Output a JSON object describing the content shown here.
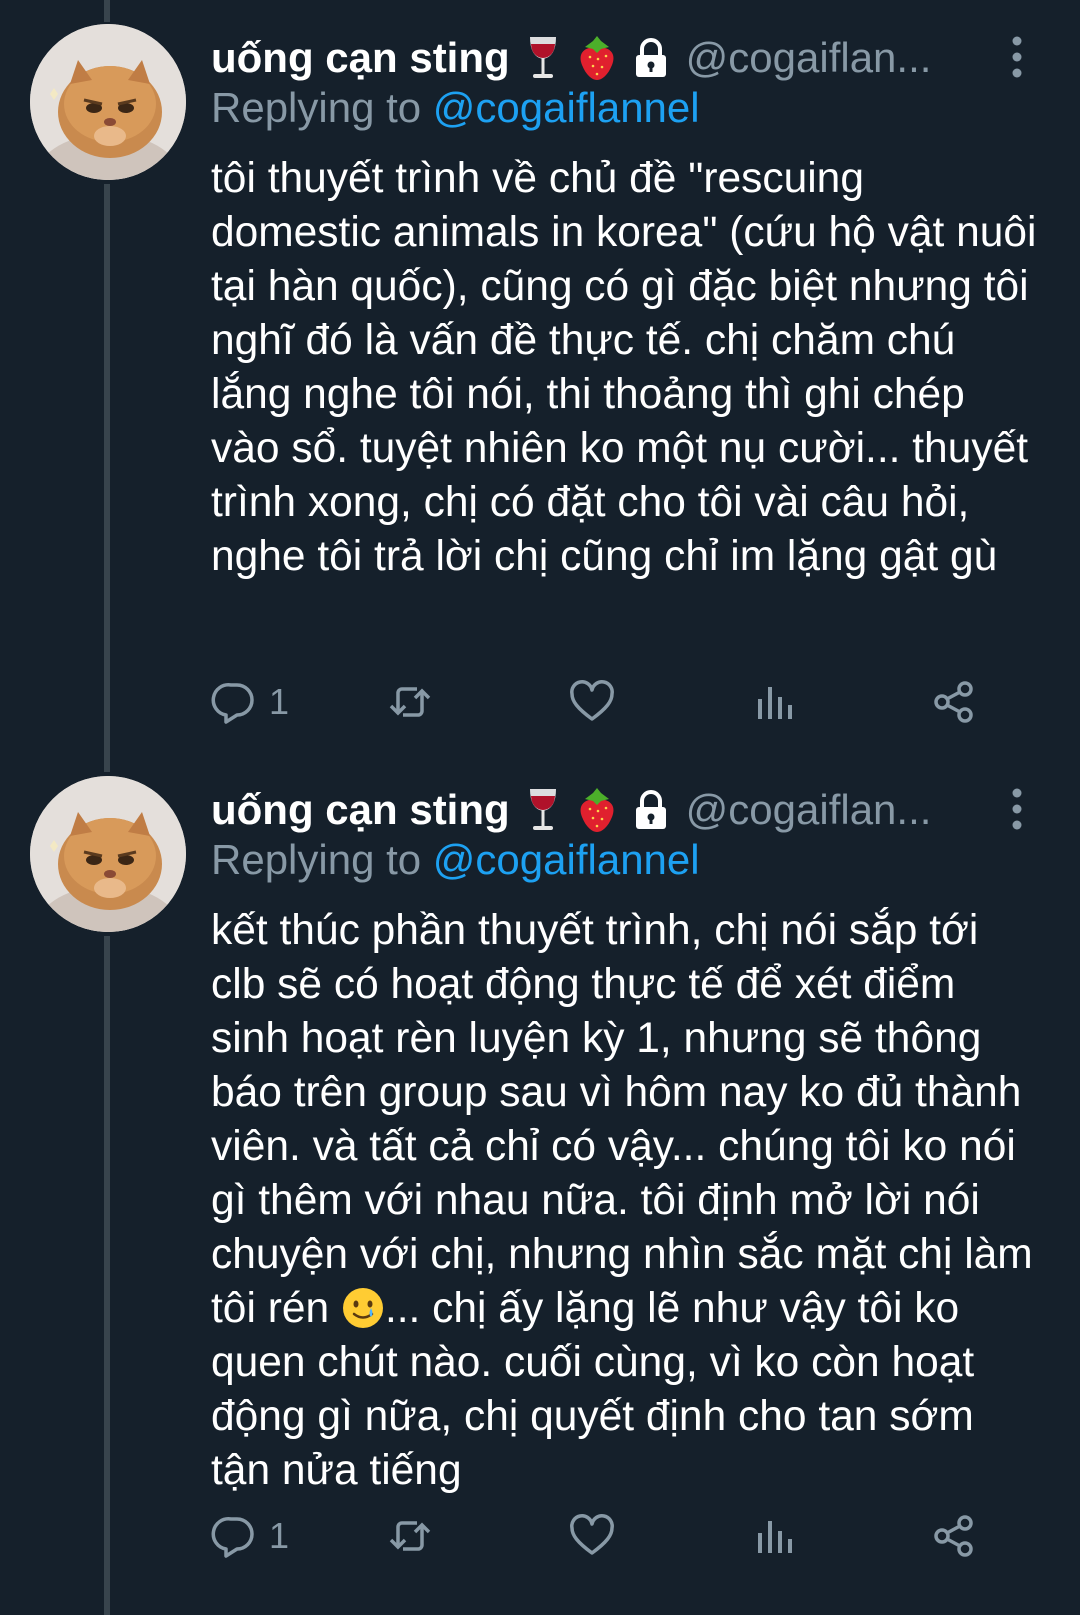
{
  "tweets": [
    {
      "display_name": "uống cạn sting",
      "badges": [
        "wine-glass-emoji",
        "strawberry-emoji",
        "lock-icon"
      ],
      "handle": "@cogaiflan...",
      "replying_prefix": "Replying to ",
      "replying_to": "@cogaiflannel",
      "text": "tôi thuyết trình về chủ đề \"rescuing domestic animals in korea\" (cứu hộ vật nuôi tại hàn quốc), cũng có gì đặc biệt nhưng tôi nghĩ đó là vấn đề thực tế. chị chăm chú lắng nghe tôi nói, thi thoảng thì ghi chép vào sổ. tuyệt nhiên ko một nụ cười... thuyết trình xong, chị có đặt cho tôi vài câu hỏi, nghe tôi trả lời chị cũng chỉ im lặng gật gù",
      "reply_count": "1"
    },
    {
      "display_name": "uống cạn sting",
      "badges": [
        "wine-glass-emoji",
        "strawberry-emoji",
        "lock-icon"
      ],
      "handle": "@cogaiflan...",
      "replying_prefix": "Replying to ",
      "replying_to": "@cogaiflannel",
      "text_before_emoji": "kết thúc phần thuyết trình, chị nói sắp tới clb sẽ có hoạt động thực tế để xét điểm sinh hoạt rèn luyện kỳ 1, nhưng sẽ thông báo trên group sau vì hôm nay ko đủ thành viên. và tất cả chỉ có vậy... chúng tôi ko nói gì thêm với nhau nữa. tôi định mở lời nói chuyện với chị, nhưng nhìn sắc mặt chị làm tôi rén ",
      "inline_emoji": "smiling-face-with-tear-emoji",
      "text_after_emoji": "... chị ấy lặng lẽ như vậy tôi ko quen chút nào. cuối cùng, vì ko còn hoạt động gì nữa, chị quyết định cho tan sớm tận nửa tiếng",
      "reply_count": "1"
    }
  ],
  "colors": {
    "background": "#15202b",
    "text": "#ffffff",
    "muted": "#8899a6",
    "link": "#1da1f2",
    "thread_line": "#38444d"
  }
}
